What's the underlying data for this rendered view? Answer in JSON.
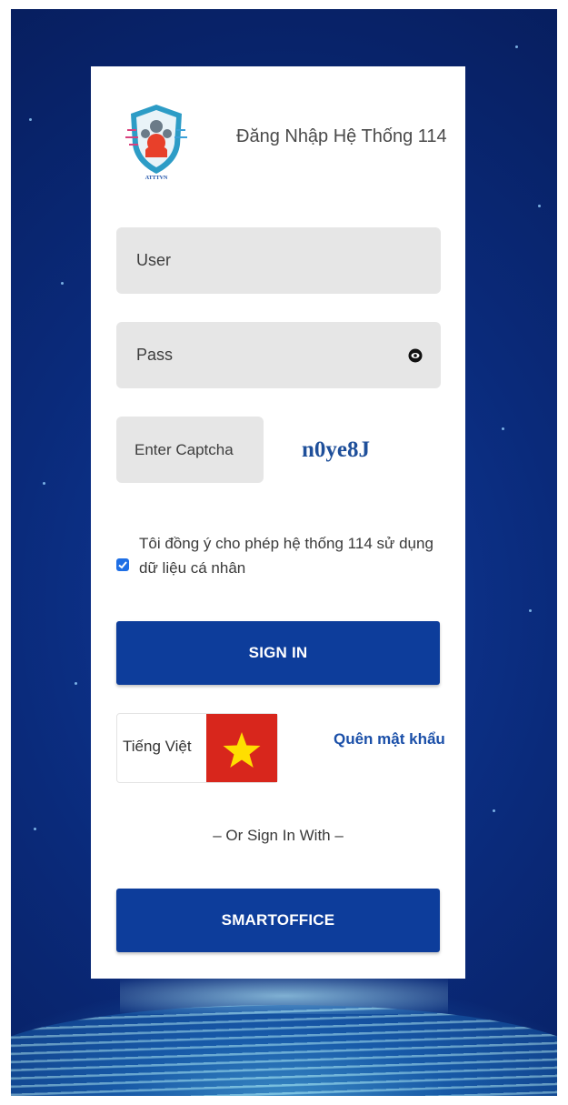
{
  "login": {
    "title": "Đăng Nhập Hệ Thống 114",
    "logo_caption": "ATTTVN",
    "user_placeholder": "User",
    "pass_placeholder": "Pass",
    "captcha_placeholder": "Enter Captcha",
    "captcha_code": "n0ye8J",
    "consent_text": "Tôi đồng ý cho phép hệ thống 114 sử dụng dữ liệu cá nhân",
    "consent_checked": true,
    "signin_label": "SIGN IN",
    "language_label": "Tiếng Việt",
    "forgot_label": "Quên mật khẩu",
    "divider_text": "– Or Sign In With –",
    "smartoffice_label": "SMARTOFFICE"
  },
  "icons": {
    "logo": "shield-logo-icon",
    "eye": "eye-icon",
    "flag": "vietnam-flag-icon",
    "checkbox": "checkmark-icon"
  },
  "colors": {
    "primary_button": "#0d3d9b",
    "link": "#1a4fa8",
    "captcha": "#1e4f9a",
    "field_bg": "#e6e6e6",
    "flag_red": "#d8261c",
    "flag_star": "#ffde00"
  }
}
